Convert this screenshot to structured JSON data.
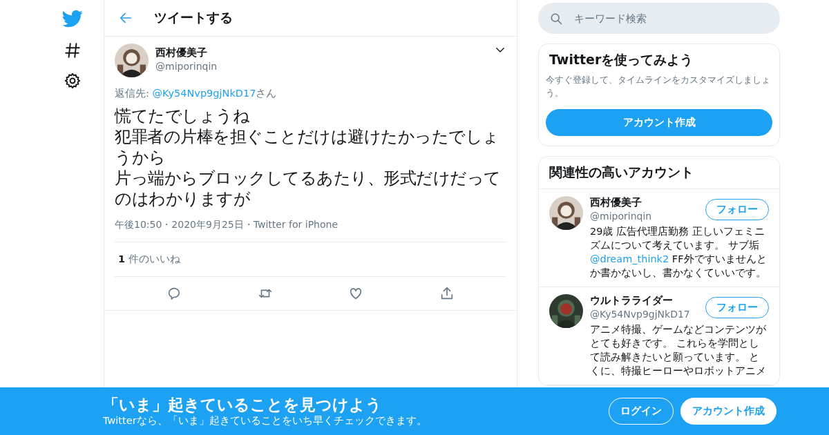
{
  "header": {
    "title": "ツイートする"
  },
  "tweet": {
    "author_name": "西村優美子",
    "handle": "@miporinqin",
    "reply_prefix": "返信先: ",
    "reply_handle": "@Ky54Nvp9gjNkD17",
    "reply_suffix": "さん",
    "text": [
      "慌てたでしょうね",
      "犯罪者の片棒を担ぐことだけは避けたかったでしょうから",
      "片っ端からブロックしてるあたり、形式だけだってのはわかりますが"
    ],
    "meta": "午後10:50・2020年9月25日・Twitter for iPhone",
    "likes_count": "1",
    "likes_label": "件のいいね"
  },
  "search": {
    "placeholder": "キーワード検索"
  },
  "signup_card": {
    "title": "Twitterを使ってみよう",
    "description": "今すぐ登録して、タイムラインをカスタマイズしましょう。",
    "button": "アカウント作成"
  },
  "related": {
    "title": "関連性の高いアカウント",
    "accounts": [
      {
        "name": "西村優美子",
        "handle": "@miporinqin",
        "follow": "フォロー",
        "bio": [
          {
            "kind": "text",
            "text": "29歳 広告代理店勤務 正しいフェミニズムについて考えています。 サブ垢 "
          },
          {
            "kind": "mention",
            "text": "@dream_think2"
          },
          {
            "kind": "text",
            "text": " FF外ですいませんとか書かないし、書かなくていいです。"
          }
        ]
      },
      {
        "name": "ウルトラライダー",
        "handle": "@Ky54Nvp9gjNkD17",
        "follow": "フォロー",
        "bio": [
          {
            "kind": "text",
            "text": "アニメ特撮、ゲームなどコンテンツがとても好きです。 これらを学問として読み解きたいと願っています。 とくに、特撮ヒーローやロボットアニメ"
          }
        ]
      }
    ]
  },
  "banner": {
    "title": "「いま」起きていることを見つけよう",
    "subtitle": "Twitterなら、「いま」起きていることをいち早くチェックできます。",
    "buttons": [
      {
        "label": "ログイン",
        "kind": "outline"
      },
      {
        "label": "アカウント作成",
        "kind": "filled"
      }
    ]
  }
}
